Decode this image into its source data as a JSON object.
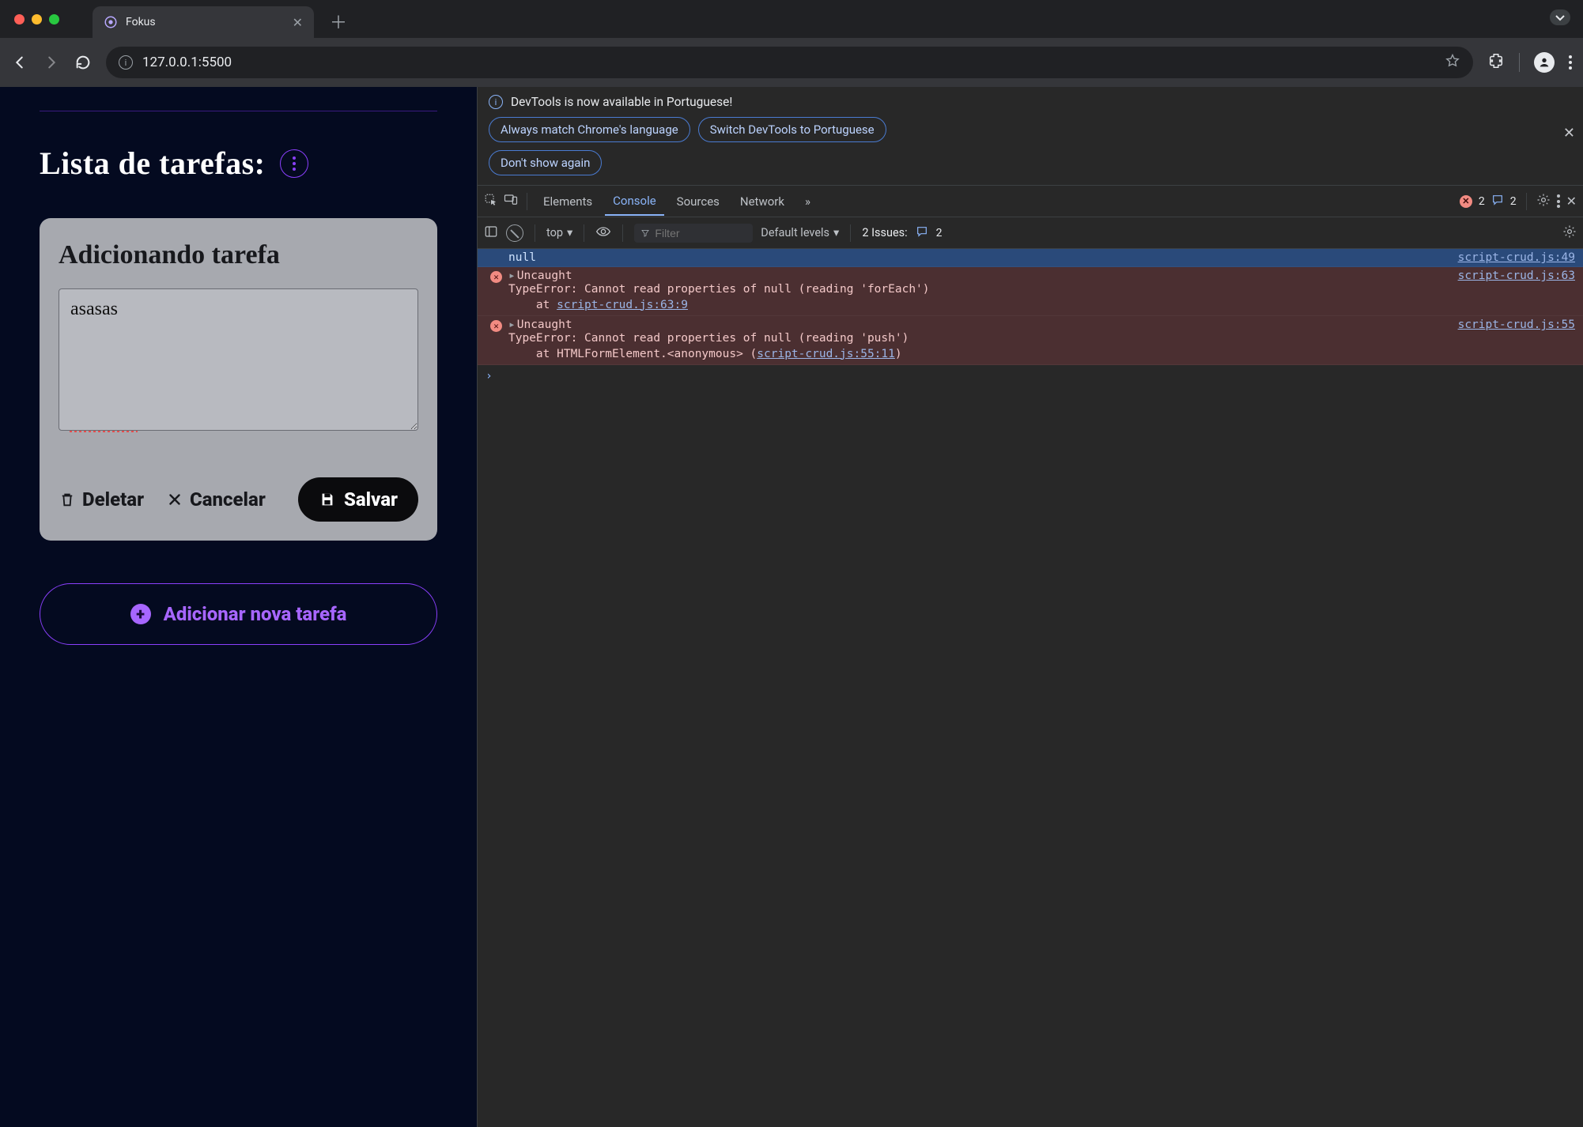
{
  "browser": {
    "tab_title": "Fokus",
    "url": "127.0.0.1:5500"
  },
  "app": {
    "heading": "Lista de tarefas:",
    "card_title": "Adicionando tarefa",
    "textarea_value": "asasas",
    "btn_delete": "Deletar",
    "btn_cancel": "Cancelar",
    "btn_save": "Salvar",
    "btn_add_task": "Adicionar nova tarefa"
  },
  "devtools": {
    "info_text": "DevTools is now available in Portuguese!",
    "chip_match": "Always match Chrome's language",
    "chip_switch": "Switch DevTools to Portuguese",
    "chip_dont": "Don't show again",
    "tabs": {
      "elements": "Elements",
      "console": "Console",
      "sources": "Sources",
      "network": "Network"
    },
    "error_badge": "2",
    "msg_badge": "2",
    "context": "top",
    "filter_placeholder": "Filter",
    "levels": "Default levels",
    "issues_label": "2 Issues:",
    "issues_count": "2",
    "log_null": "null",
    "log_null_src": "script-crud.js:49",
    "err1_src": "script-crud.js:63",
    "err1_head": "Uncaught",
    "err1_line1": "TypeError: Cannot read properties of null (reading 'forEach')",
    "err1_line2_pre": "    at ",
    "err1_line2_link": "script-crud.js:63:9",
    "err2_src": "script-crud.js:55",
    "err2_head": "Uncaught",
    "err2_line1": "TypeError: Cannot read properties of null (reading 'push')",
    "err2_line2_pre": "    at HTMLFormElement.<anonymous> (",
    "err2_line2_link": "script-crud.js:55:11",
    "err2_line2_post": ")"
  }
}
